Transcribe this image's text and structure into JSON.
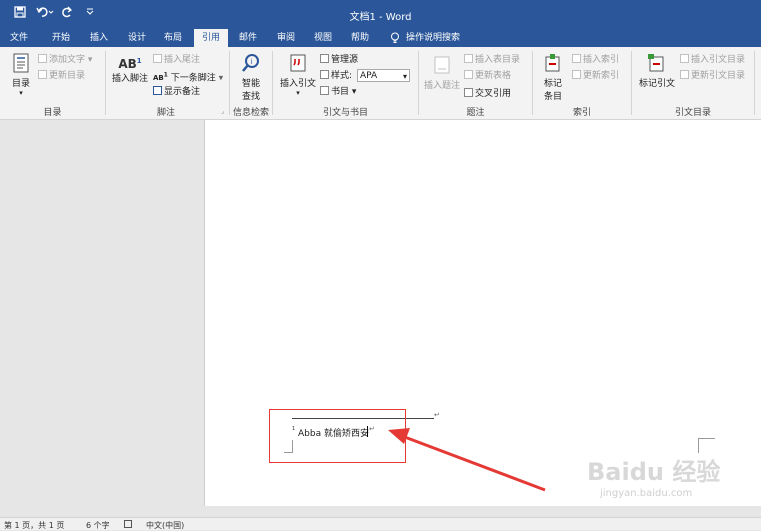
{
  "window": {
    "title": "文档1 - Word"
  },
  "quick_access": {
    "save_icon": "save-icon",
    "undo_icon": "undo-icon",
    "redo_icon": "redo-icon",
    "customize_icon": "customize-qat-icon"
  },
  "tabs": [
    "文件",
    "开始",
    "插入",
    "设计",
    "布局",
    "引用",
    "邮件",
    "审阅",
    "视图",
    "帮助"
  ],
  "active_tab": "引用",
  "tell_me": "操作说明搜索",
  "ribbon": {
    "toc": {
      "big_label": "目录",
      "add_text": "添加文字",
      "update_toc": "更新目录",
      "group": "目录"
    },
    "footnotes": {
      "big_label": "插入脚注",
      "insert_endnote": "插入尾注",
      "next_footnote": "下一条脚注",
      "show_notes": "显示备注",
      "group": "脚注"
    },
    "research": {
      "big_label_1": "智能",
      "big_label_2": "查找",
      "group": "信息检索"
    },
    "citations": {
      "big_label": "插入引文",
      "manage_sources": "管理源",
      "style_label": "样式:",
      "style_value": "APA",
      "bibliography": "书目",
      "group": "引文与书目"
    },
    "captions": {
      "big_label": "插入题注",
      "insert_tof": "插入表目录",
      "update_table": "更新表格",
      "cross_ref": "交叉引用",
      "group": "题注"
    },
    "index": {
      "big_label_1": "标记",
      "big_label_2": "条目",
      "insert_index": "插入索引",
      "update_index": "更新索引",
      "group": "索引"
    },
    "toa": {
      "big_label": "标记引文",
      "insert_toa": "插入引文目录",
      "update_toa": "更新引文目录",
      "group": "引文目录"
    }
  },
  "document": {
    "footnote_number": "1",
    "footnote_text": "Abba 就偷矫西安",
    "paragraph_mark": "↵"
  },
  "status": {
    "page": "第 1 页，共 1 页",
    "words": "6 个字",
    "language": "中文(中国)"
  },
  "watermark": {
    "line1": "Baidu 经验",
    "line2": "jingyan.baidu.com"
  },
  "colors": {
    "accent": "#2b579a",
    "annotation": "#e53935"
  }
}
